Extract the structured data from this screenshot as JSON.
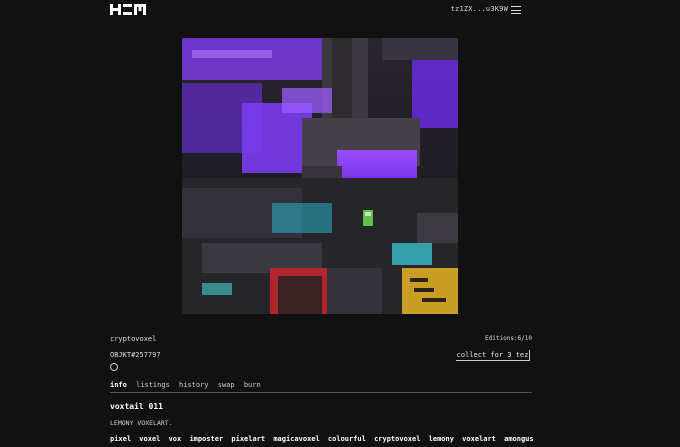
{
  "header": {
    "wallet_address": "tz1ZX...u3K9W",
    "logo_icon": "hen-logo",
    "menu_icon": "hamburger-icon"
  },
  "artwork": {
    "icon": "voxel-artwork-image"
  },
  "info": {
    "creator": "cryptovoxel",
    "editions": "Editions:6/10",
    "objkt": "OBJKT#257797",
    "collect_label": "collect for 3 tez",
    "favorite_icon": "circle-icon"
  },
  "tabs": [
    "info",
    "listings",
    "history",
    "swap",
    "burn"
  ],
  "content": {
    "title": "voxtail 011",
    "description": "LEMONY VOXELART.",
    "tags": [
      "pixel",
      "voxel",
      "vox",
      "imposter",
      "pixelart",
      "magicavoxel",
      "colourful",
      "cryptovoxel",
      "lemony",
      "voxelart",
      "amongus"
    ]
  },
  "colors": {
    "background": "#111111",
    "text": "#e6e6e6",
    "accent_purple": "#7a2cff"
  }
}
